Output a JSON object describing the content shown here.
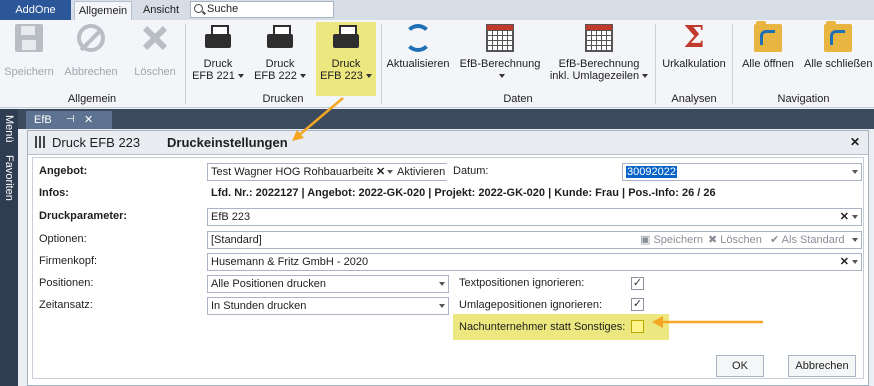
{
  "tabs": {
    "app": "AddOne",
    "items": [
      "Allgemein",
      "Ansicht"
    ],
    "search_placeholder": "Suche"
  },
  "ribbon": {
    "groups": {
      "allgemein": "Allgemein",
      "drucken": "Drucken",
      "daten": "Daten",
      "analysen": "Analysen",
      "navigation": "Navigation"
    },
    "buttons": {
      "speichern": "Speichern",
      "abbrechen": "Abbrechen",
      "loeschen": "Löschen",
      "druck221_l1": "Druck",
      "druck221_l2": "EFB 221",
      "druck222_l1": "Druck",
      "druck222_l2": "EFB 222",
      "druck223_l1": "Druck",
      "druck223_l2": "EFB 223",
      "aktualisieren": "Aktualisieren",
      "efb_berechnung": "EfB-Berechnung",
      "efb_umlage_l1": "EfB-Berechnung",
      "efb_umlage_l2": "inkl. Umlagezeilen",
      "urkalkulation": "Urkalkulation",
      "alle_oeffnen": "Alle öffnen",
      "alle_schliessen": "Alle schließen"
    }
  },
  "sidebar": {
    "menu": "Menü",
    "favoriten": "Favoriten"
  },
  "doc_tab": {
    "label": "EfB",
    "pin": "⊣",
    "close": "✕"
  },
  "panel": {
    "title": "Druck EFB 223",
    "subtitle": "Druckeinstellungen",
    "close": "✕"
  },
  "form": {
    "angebot_label": "Angebot:",
    "angebot_value": "Test Wagner HOG Rohbauarbeiten",
    "aktivieren": "Aktivieren",
    "datum_label": "Datum:",
    "datum_value": "30092022",
    "infos_label": "Infos:",
    "infos_value": "Lfd. Nr.: 2022127  |  Angebot: 2022-GK-020  |  Projekt: 2022-GK-020  |  Kunde: Frau  |  Pos.-Info: 26 / 26",
    "druckparameter_label": "Druckparameter:",
    "druckparameter_value": "EfB 223",
    "optionen_label": "Optionen:",
    "optionen_value": "[Standard]",
    "opt_speichern": "Speichern",
    "opt_loeschen": "Löschen",
    "opt_als_standard": "Als Standard",
    "firmenkopf_label": "Firmenkopf:",
    "firmenkopf_value": "Husemann & Fritz GmbH - 2020",
    "positionen_label": "Positionen:",
    "positionen_value": "Alle Positionen drucken",
    "zeitansatz_label": "Zeitansatz:",
    "zeitansatz_value": "In Stunden drucken",
    "textpos_label": "Textpositionen ignorieren:",
    "umlagepos_label": "Umlagepositionen ignorieren:",
    "nachunternehmer_label": "Nachunternehmer statt Sonstiges:",
    "ok": "OK",
    "abbrechen": "Abbrechen"
  },
  "colors": {
    "highlight": "#ece77e",
    "arrow": "#f5a623",
    "addone_tab": "#2b579a",
    "selection": "#0a64c8"
  }
}
